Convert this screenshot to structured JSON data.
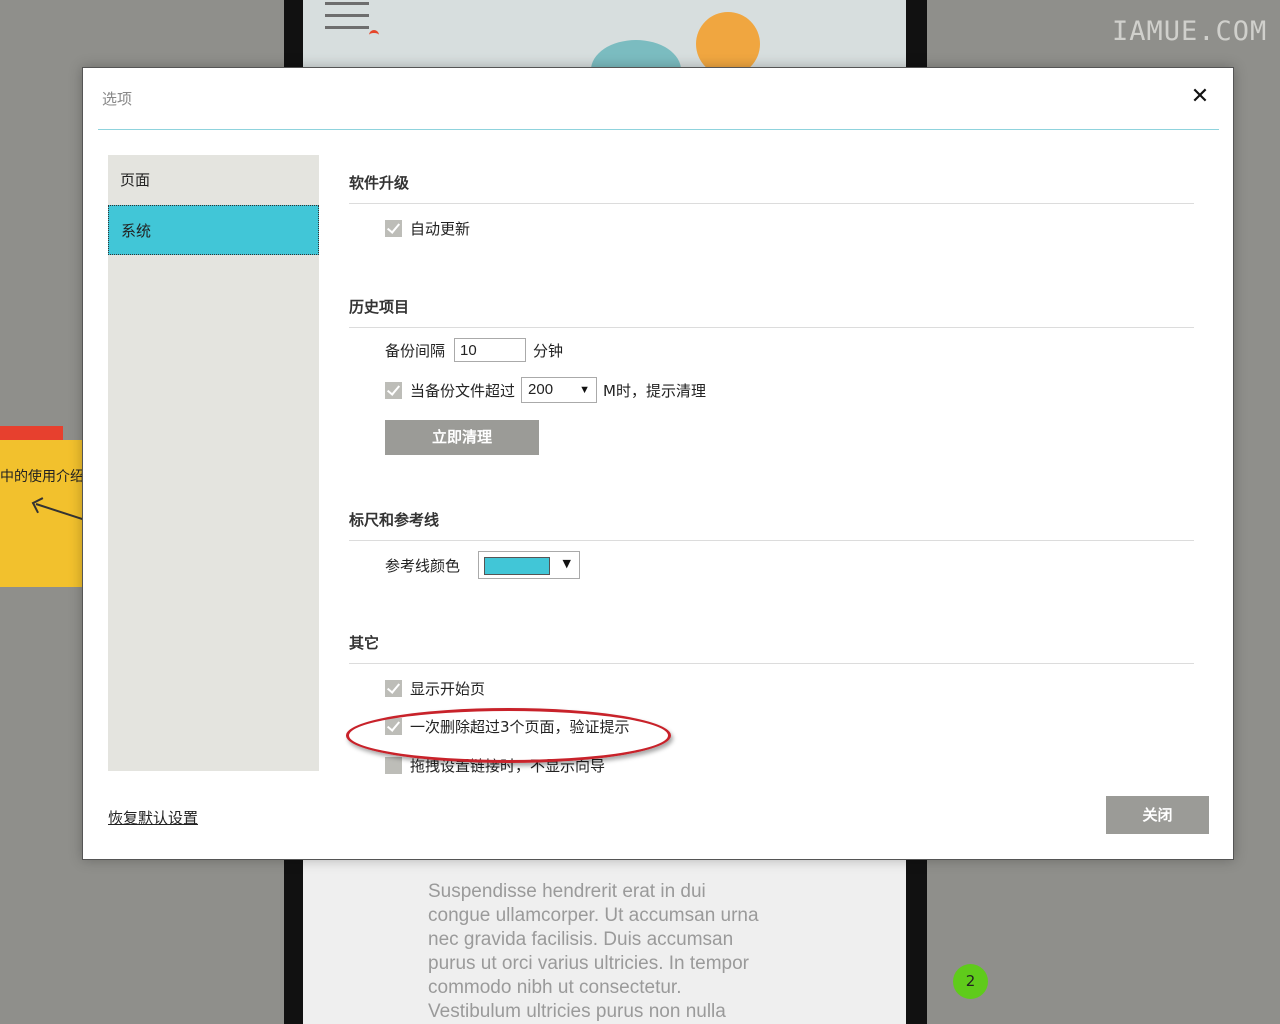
{
  "watermark": "IAMUE.COM",
  "background": {
    "sticky_note_text": "中的使用介绍",
    "lorem_lines": [
      "Suspendisse hendrerit erat in dui",
      "congue ullamcorper. Ut accumsan urna",
      "nec gravida facilisis. Duis accumsan",
      "purus ut orci varius ultricies. In tempor",
      "commodo nibh ut consectetur.",
      "Vestibulum ultricies purus non nulla"
    ],
    "page_badge": "2"
  },
  "dialog": {
    "title": "选项",
    "close_icon": "close-icon",
    "sidebar": {
      "items": [
        {
          "label": "页面",
          "active": false
        },
        {
          "label": "系统",
          "active": true
        }
      ]
    },
    "sections": {
      "upgrade": {
        "title": "软件升级",
        "auto_update": {
          "label": "自动更新",
          "checked": true
        }
      },
      "history": {
        "title": "历史项目",
        "backup_interval_label": "备份间隔",
        "backup_interval_value": "10",
        "backup_interval_unit": "分钟",
        "size_warning": {
          "label": "当备份文件超过",
          "checked": true,
          "value": "200",
          "suffix": "M时，提示清理"
        },
        "clean_button": "立即清理"
      },
      "ruler": {
        "title": "标尺和参考线",
        "guide_color_label": "参考线颜色",
        "guide_color": "#41c6d7"
      },
      "other": {
        "title": "其它",
        "show_start_page": {
          "label": "显示开始页",
          "checked": true
        },
        "confirm_delete": {
          "label": "一次删除超过3个页面，验证提示",
          "checked": true
        },
        "drag_link": {
          "label": "拖拽设置链接时，不显示向导",
          "checked": false
        }
      }
    },
    "restore_defaults": "恢复默认设置",
    "close_button": "关闭"
  },
  "colors": {
    "accent": "#41c6d7",
    "annotation": "#c8222a",
    "button": "#9b9b97"
  }
}
